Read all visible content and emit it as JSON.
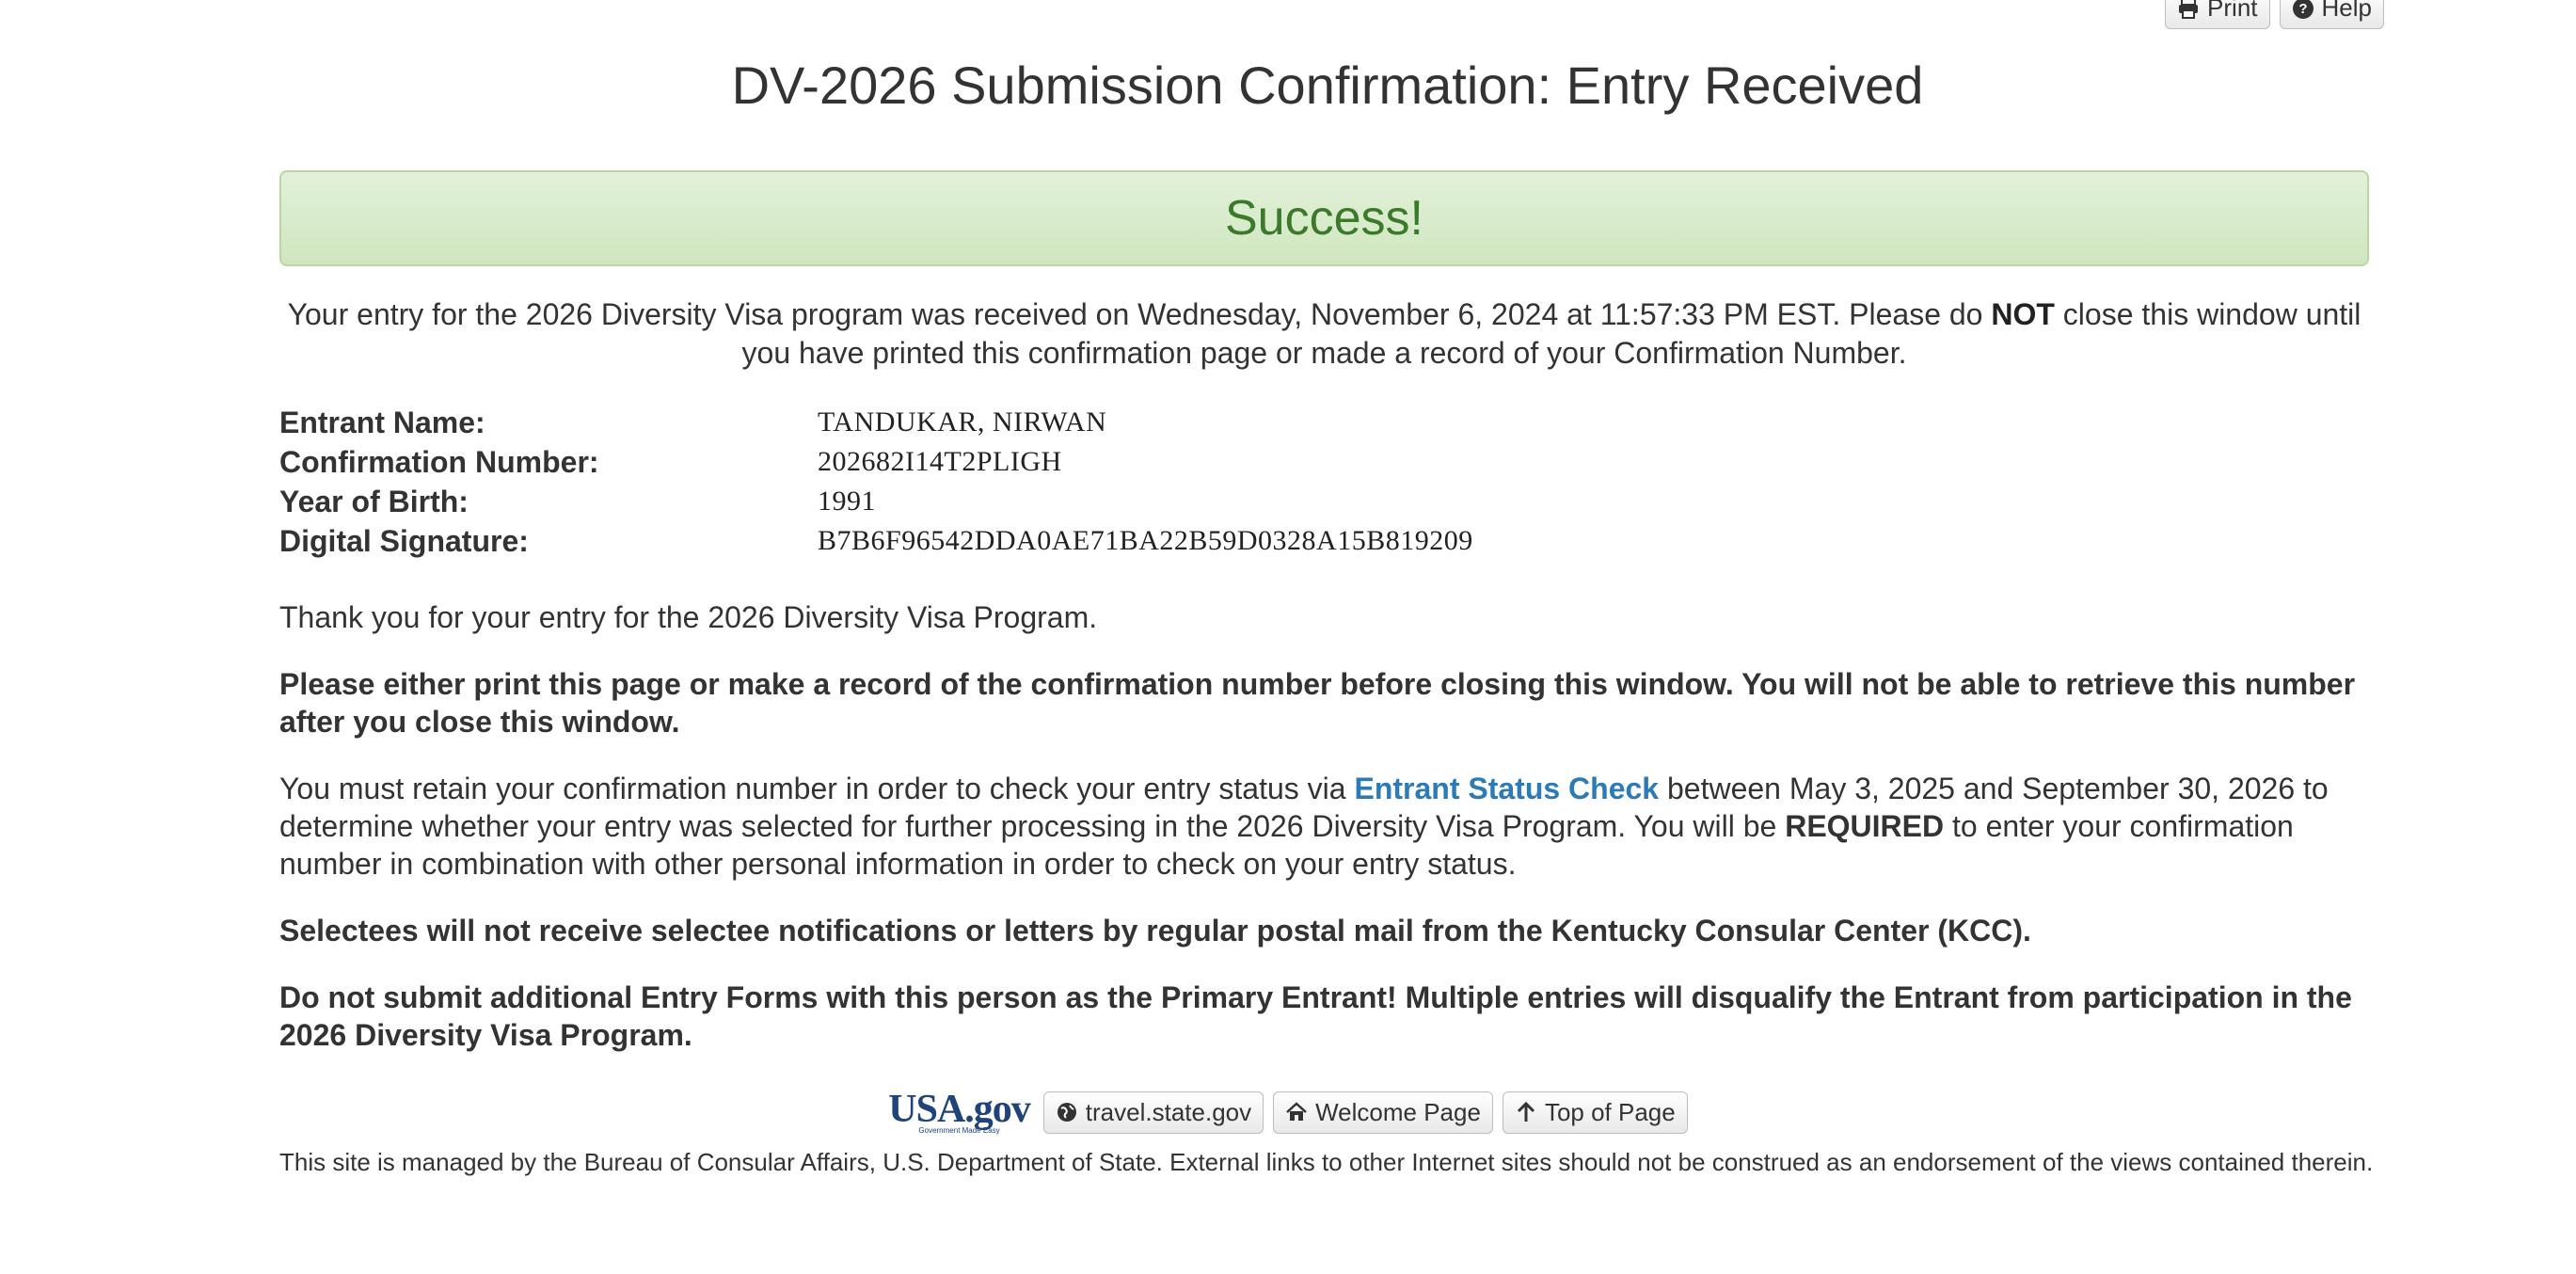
{
  "toolbar": {
    "print_label": "Print",
    "help_label": "Help"
  },
  "page_title": "DV-2026 Submission Confirmation: Entry Received",
  "success_label": "Success!",
  "notice": {
    "part1": "Your entry for the 2026 Diversity Visa program was received on Wednesday, November 6, 2024 at 11:57:33 PM EST. Please do ",
    "emphasis": "NOT",
    "part2": " close this window until you have printed this confirmation page or made a record of your Confirmation Number."
  },
  "entrant": {
    "name_label": "Entrant Name:",
    "name_value": "TANDUKAR, NIRWAN",
    "confirmation_label": "Confirmation Number:",
    "confirmation_value": "202682I14T2PLIGH",
    "birth_year_label": "Year of Birth:",
    "birth_year_value": "1991",
    "signature_label": "Digital Signature:",
    "signature_value": "B7B6F96542DDA0AE71BA22B59D0328A15B819209"
  },
  "content": {
    "thanks": "Thank you for your entry for the 2026 Diversity Visa Program.",
    "print_warning": "Please either print this page or make a record of the confirmation number before closing this window. You will not be able to retrieve this number after you close this window.",
    "retain_part1": "You must retain your confirmation number in order to check your entry status via ",
    "retain_link": "Entrant Status Check",
    "retain_part2": " between May 3, 2025 and September 30, 2026 to determine whether your entry was selected for further processing in the 2026 Diversity Visa Program. You will be ",
    "retain_required": "REQUIRED",
    "retain_part3": " to enter your confirmation number in combination with other personal information in order to check on your entry status.",
    "mail_notice": "Selectees will not receive selectee notifications or letters by regular postal mail from the Kentucky Consular Center (KCC).",
    "duplicate_warning": "Do not submit additional Entry Forms with this person as the Primary Entrant! Multiple entries will disqualify the Entrant from participation in the 2026 Diversity Visa Program."
  },
  "footer": {
    "usagov_logo": "USA.gov",
    "usagov_tagline": "Government Made Easy",
    "travel_label": "travel.state.gov",
    "welcome_label": "Welcome Page",
    "top_label": "Top of Page",
    "note": "This site is managed by the Bureau of Consular Affairs, U.S. Department of State. External links to other Internet sites should not be construed as an endorsement of the views contained therein."
  },
  "colors": {
    "link": "#2a7bb8",
    "success_text": "#3a7a2a",
    "success_bg": "#d6ebc8"
  }
}
